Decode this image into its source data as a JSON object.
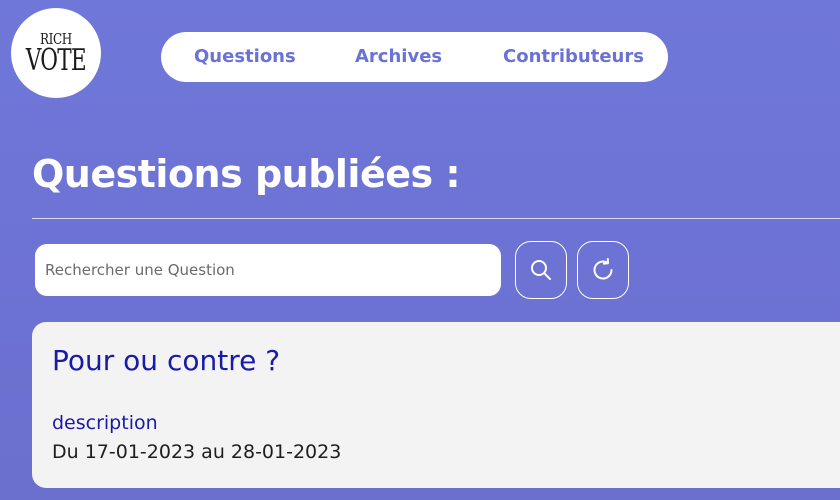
{
  "logo": {
    "line1": "RICH",
    "line2": "VOTE"
  },
  "nav": {
    "items": [
      {
        "label": "Questions"
      },
      {
        "label": "Archives"
      },
      {
        "label": "Contributeurs"
      }
    ]
  },
  "page": {
    "title": "Questions publiées :"
  },
  "search": {
    "placeholder": "Rechercher une Question",
    "value": "",
    "search_icon": "magnifier-icon",
    "refresh_icon": "refresh-icon"
  },
  "questions": [
    {
      "title": "Pour ou contre ?",
      "description": "description",
      "dates": "Du 17-01-2023 au 28-01-2023"
    }
  ],
  "colors": {
    "background": "#6f77d9",
    "nav_text": "#6a72d6",
    "card_title": "#1a1aa8",
    "card_background": "#f3f3f3"
  }
}
